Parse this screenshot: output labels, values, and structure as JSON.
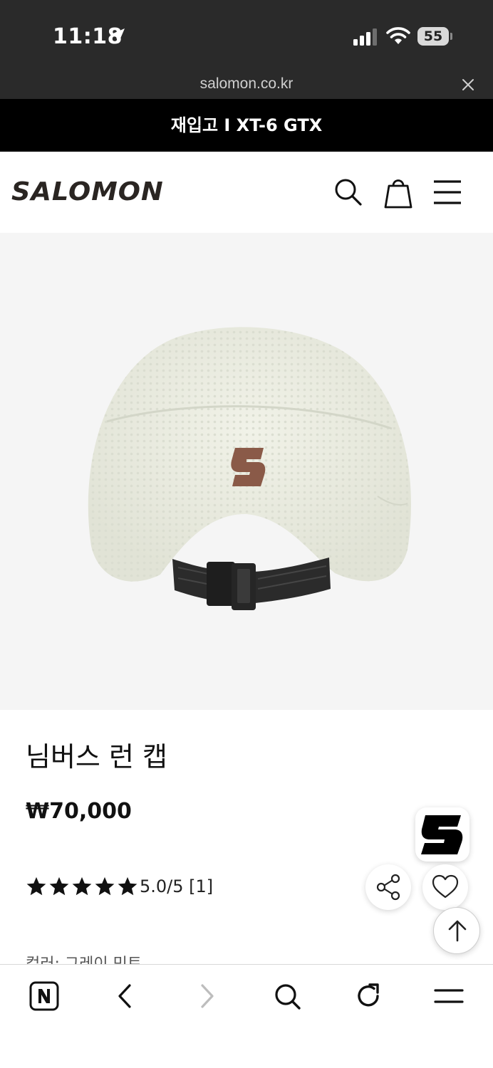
{
  "status_bar": {
    "time": "11:18",
    "battery": "55"
  },
  "browser": {
    "url": "salomon.co.kr"
  },
  "promo_banner": {
    "text": "재입고 I XT-6 GTX"
  },
  "header": {
    "logo": "SALOMON",
    "icons": [
      "search-icon",
      "shopping-bag-icon",
      "hamburger-menu-icon"
    ]
  },
  "product": {
    "name": "님버스 런 캡",
    "price": "₩70,000",
    "rating_value": 5,
    "rating_max": 5,
    "rating_text": "5.0/5 [1]",
    "color_label": "컬러: 그레이 민트"
  },
  "floating": {
    "icons": [
      "salomon-s-logo-icon",
      "share-icon",
      "heart-icon",
      "scroll-top-icon"
    ]
  },
  "toolbar": {
    "icons": [
      "naver-n-icon",
      "back-icon",
      "forward-icon",
      "search-icon",
      "reload-icon",
      "menu-icon"
    ]
  },
  "colors": {
    "status_bg": "#2a2a2a",
    "banner_bg": "#000000",
    "logo": "#2a2522",
    "image_bg": "#f5f5f5",
    "cap_logo": "#8a5a48"
  }
}
